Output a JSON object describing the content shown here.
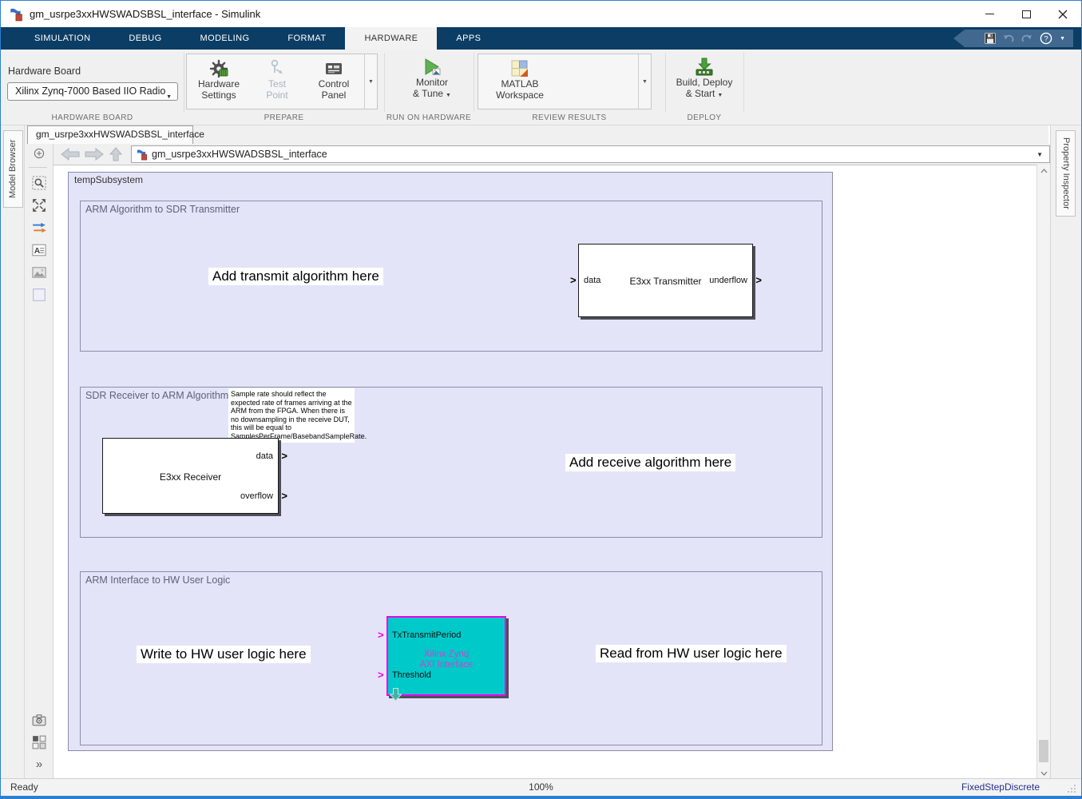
{
  "colors": {
    "ribbon-navy": "#0c3d64",
    "qa-blue": "#41688f",
    "toolstrip-bg": "#f0f0f0",
    "canvas-lavender": "#e4e4f8",
    "area-border": "#8c8ca8",
    "block-cyan": "#00c9c9",
    "block-magenta": "#ee00ee",
    "magenta-text": "#cc44cc",
    "solver-blue": "#24318f",
    "win-border": "#2d7fd0"
  },
  "icons": {
    "dropdown_caret": "▼",
    "port_chevron": ">",
    "double_chevron": "»",
    "help_q": "?",
    "annotation_a": "A"
  },
  "titlebar": {
    "title": "gm_usrpe3xxHWSWADSBSL_interface - Simulink"
  },
  "ribbon": {
    "tabs": [
      "SIMULATION",
      "DEBUG",
      "MODELING",
      "FORMAT",
      "HARDWARE",
      "APPS"
    ],
    "active": "HARDWARE"
  },
  "toolstrip": {
    "hardware_board": {
      "label": "Hardware Board",
      "value": "Xilinx Zynq-7000 Based IIO Radio",
      "section": "HARDWARE BOARD"
    },
    "prepare": {
      "section": "PREPARE",
      "hardware_settings": {
        "line1": "Hardware",
        "line2": "Settings"
      },
      "test_point": {
        "line1": "Test",
        "line2": "Point"
      },
      "control_panel": {
        "line1": "Control",
        "line2": "Panel"
      }
    },
    "run_on_hardware": {
      "section": "RUN ON HARDWARE",
      "monitor_tune": {
        "line1": "Monitor",
        "line2": "& Tune"
      }
    },
    "review_results": {
      "section": "REVIEW RESULTS",
      "matlab_workspace": {
        "line1": "MATLAB",
        "line2": "Workspace"
      }
    },
    "deploy": {
      "section": "DEPLOY",
      "build_deploy": {
        "line1": "Build, Deploy",
        "line2": "& Start"
      }
    }
  },
  "document": {
    "tab_title": "gm_usrpe3xxHWSWADSBSL_interface",
    "breadcrumb": "gm_usrpe3xxHWSWADSBSL_interface"
  },
  "panels": {
    "left_tab": "Model Browser",
    "right_tab": "Property Inspector"
  },
  "canvas": {
    "subsystem_label": "tempSubsystem",
    "areas": [
      {
        "title": "ARM Algorithm to SDR Transmitter",
        "note": "Add transmit algorithm here"
      },
      {
        "title": "SDR Receiver to ARM Algorithm",
        "annotation": "Sample rate should reflect the expected rate of frames arriving at the ARM from the FPGA. When there is no downsampling in the receive DUT, this will be equal to SamplesPerFrame/BasebandSampleRate.",
        "note": "Add receive algorithm here"
      },
      {
        "title": "ARM Interface to HW User Logic",
        "note_left": "Write to HW user logic here",
        "note_right": "Read from HW user logic here"
      }
    ],
    "blocks": {
      "transmitter": {
        "label": "E3xx Transmitter",
        "input": "data",
        "output": "underflow"
      },
      "receiver": {
        "label": "E3xx Receiver",
        "output1": "data",
        "output2": "overflow"
      },
      "axi": {
        "line1": "Xilinx Zynq",
        "line2": "AXI Interface",
        "input1": "TxTransmitPeriod",
        "input2": "Threshold"
      }
    }
  },
  "statusbar": {
    "left": "Ready",
    "zoom": "100%",
    "right": "FixedStepDiscrete"
  }
}
